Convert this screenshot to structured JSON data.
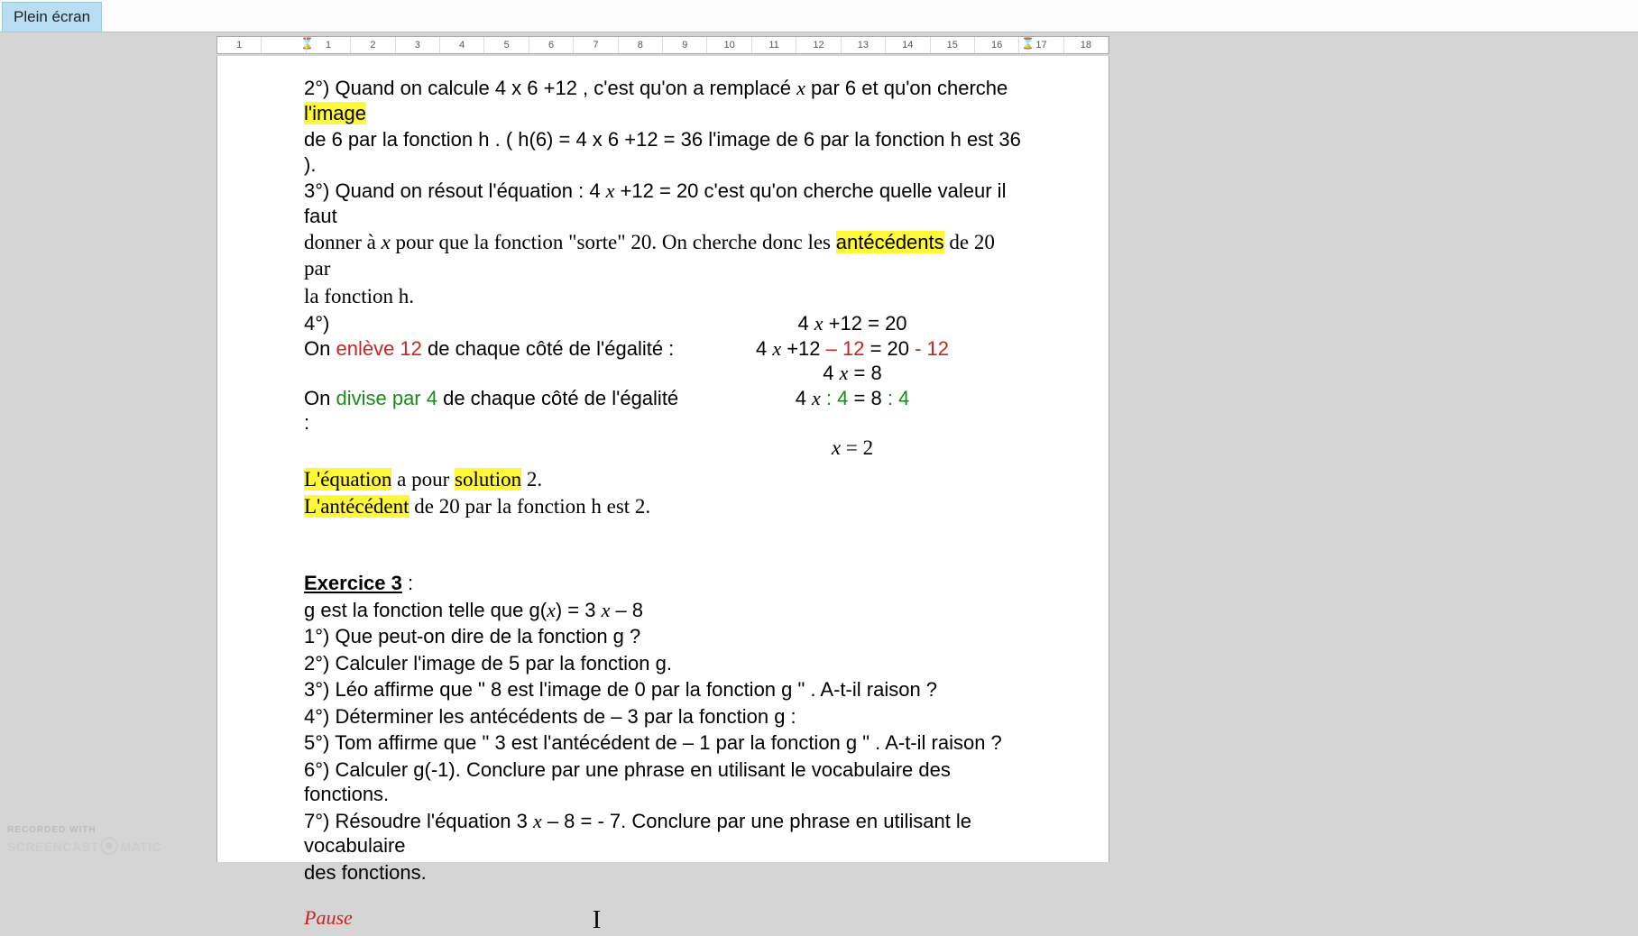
{
  "ui": {
    "fullscreen_label": "Plein écran",
    "ruler_marks": [
      "1",
      "",
      "1",
      "2",
      "3",
      "4",
      "5",
      "6",
      "7",
      "8",
      "9",
      "10",
      "11",
      "12",
      "13",
      "14",
      "15",
      "16",
      "17",
      "18"
    ]
  },
  "doc": {
    "l1_pre": "2°) Quand on calcule  4 x 6 +12  , c'est qu'on a remplacé ",
    "l1_x": "x",
    "l1_mid": " par 6 et qu'on cherche ",
    "l1_hl": "l'image",
    "l2": "de 6 par la fonction h . (   h(6) =   4 x 6 +12 = 36   l'image de 6 par la fonction h est 36 ).",
    "l3_a": "3°)  Quand on  résout l'équation : 4 ",
    "l3_x": "x",
    "l3_b": " +12 = 20   c'est qu'on cherche quelle valeur il faut",
    "l4_a": "donner à  ",
    "l4_x": "x",
    "l4_b": " pour que la fonction \"sorte\" 20. On cherche donc les ",
    "l4_hl": "antécédents",
    "l4_c": " de 20 par",
    "l5": "la fonction h.",
    "l6_left": "4°)",
    "l6_right_a": "4 ",
    "l6_right_x": "x",
    "l6_right_b": " +12 = 20",
    "l7_left_a": "On ",
    "l7_left_red": "enlève 12",
    "l7_left_b": " de chaque côté de l'égalité :",
    "l7_right_a": "4 ",
    "l7_right_x": "x",
    "l7_right_b": " +12 ",
    "l7_right_red1": "– 12",
    "l7_right_c": " = 20  ",
    "l7_right_red2": "- 12",
    "l8_a": "4 ",
    "l8_x": "x",
    "l8_b": "  = 8",
    "l9_left_a": "On ",
    "l9_left_grn": "divise par 4",
    "l9_left_b": " de chaque côté de l'égalité :",
    "l9_right_a": "4 ",
    "l9_right_x": "x",
    "l9_right_b": " ",
    "l9_right_grn1": ": 4",
    "l9_right_c": " = 8 ",
    "l9_right_grn2": ": 4",
    "l10_x": "x",
    "l10_b": " = 2",
    "l11_hl1": "L'équation",
    "l11_a": " a pour ",
    "l11_hl2": "solution",
    "l11_b": " 2.",
    "l12_hl": "L'antécédent",
    "l12_a": " de 20 par la fonction h est 2.",
    "ex3_title": "Exercice 3",
    "ex3_colon": " :",
    "ex3_l1_a": "g est la fonction telle que g(",
    "ex3_l1_x": "x",
    "ex3_l1_b": ") = 3 ",
    "ex3_l1_x2": "x",
    "ex3_l1_c": " – 8",
    "ex3_l2": "1°) Que peut-on dire de la fonction g ?",
    "ex3_l3": "2°) Calculer l'image de 5 par la fonction g.",
    "ex3_l4": "3°) Léo affirme que \" 8 est l'image de 0 par la fonction g \" . A-t-il raison ?",
    "ex3_l5": "4°) Déterminer les antécédents de – 3 par la fonction g :",
    "ex3_l6": "5°) Tom affirme que \" 3 est l'antécédent de – 1 par la fonction g \" . A-t-il raison ?",
    "ex3_l7": "6°) Calculer g(-1). Conclure par une phrase en utilisant le vocabulaire des fonctions.",
    "ex3_l8_a": "7°) Résoudre l'équation  3 ",
    "ex3_l8_x": "x",
    "ex3_l8_b": " – 8 = - 7. Conclure par une phrase en utilisant le vocabulaire",
    "ex3_l9": "des fonctions.",
    "pause": "Pause",
    "cursor_glyph": "I"
  },
  "watermark": {
    "small": "RECORDED WITH",
    "brand_a": "SCREENCAST",
    "brand_b": "MATIC"
  }
}
